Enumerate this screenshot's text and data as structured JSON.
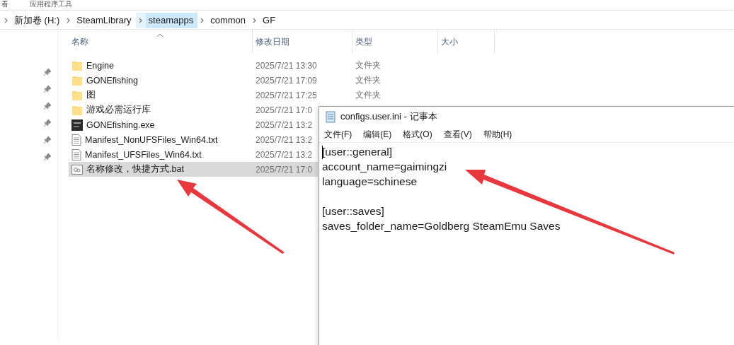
{
  "ribbon_tabs": [
    "看",
    "应用程序工具"
  ],
  "breadcrumb": [
    {
      "label": "新加卷 (H:)",
      "selected": false
    },
    {
      "label": "SteamLibrary",
      "selected": false
    },
    {
      "label": "steamapps",
      "selected": true
    },
    {
      "label": "common",
      "selected": false
    },
    {
      "label": "GF",
      "selected": false
    }
  ],
  "columns": [
    "名称",
    "修改日期",
    "类型",
    "大小"
  ],
  "files": [
    {
      "name": "Engine",
      "modified": "2025/7/21 13:30",
      "type": "文件夹",
      "kind": "folder",
      "selected": false
    },
    {
      "name": "GONEfishing",
      "modified": "2025/7/21 17:09",
      "type": "文件夹",
      "kind": "folder",
      "selected": false
    },
    {
      "name": "图",
      "modified": "2025/7/21 17:25",
      "type": "文件夹",
      "kind": "folder",
      "selected": false
    },
    {
      "name": "游戏必需运行库",
      "modified": "2025/7/21 17:0",
      "kind": "folder",
      "selected": false
    },
    {
      "name": "GONEfishing.exe",
      "modified": "2025/7/21 13:2",
      "kind": "exe",
      "selected": false
    },
    {
      "name": "Manifest_NonUFSFiles_Win64.txt",
      "modified": "2025/7/21 13:2",
      "kind": "txt",
      "selected": false
    },
    {
      "name": "Manifest_UFSFiles_Win64.txt",
      "modified": "2025/7/21 13:2",
      "kind": "txt",
      "selected": false
    },
    {
      "name": "名称修改，快捷方式.bat",
      "modified": "2025/7/21 17:0",
      "kind": "bat",
      "selected": true
    }
  ],
  "notepad": {
    "title": "configs.user.ini - 记事本",
    "menu": [
      "文件(F)",
      "编辑(E)",
      "格式(O)",
      "查看(V)",
      "帮助(H)"
    ],
    "sections": [
      {
        "lines": [
          "[user::general]",
          "account_name=gaimingzi",
          "language=schinese"
        ]
      },
      {
        "lines": [
          "[user::saves]",
          "saves_folder_name=Goldberg SteamEmu Saves"
        ]
      }
    ]
  }
}
